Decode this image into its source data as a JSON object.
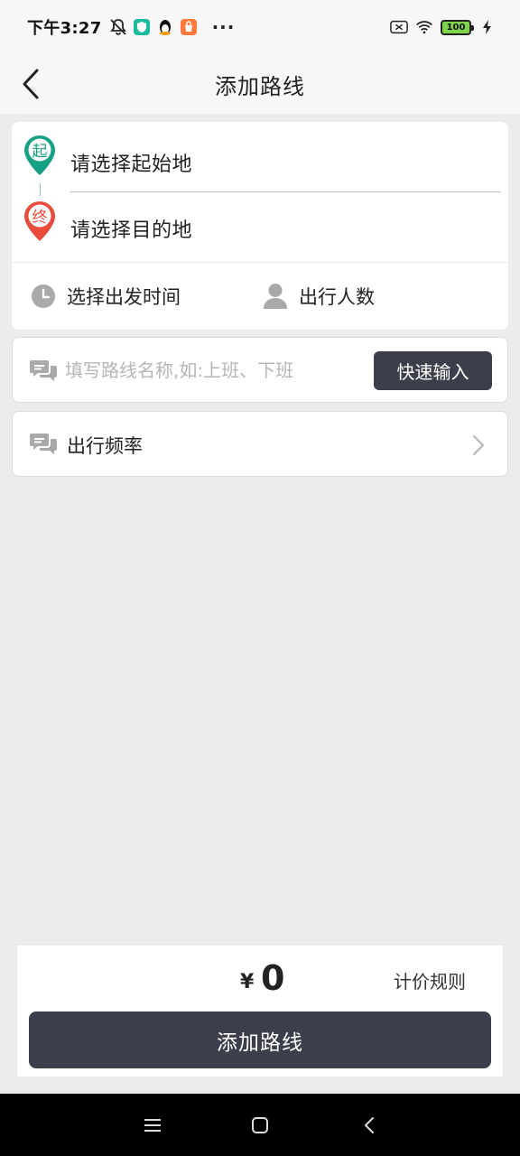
{
  "status_bar": {
    "time": "下午3:27",
    "dots": "···",
    "battery_level": "100"
  },
  "header": {
    "title": "添加路线"
  },
  "route": {
    "start_badge": "起",
    "end_badge": "终",
    "start_placeholder": "请选择起始地",
    "end_placeholder": "请选择目的地",
    "departure_time_label": "选择出发时间",
    "passengers_label": "出行人数"
  },
  "route_name": {
    "placeholder": "填写路线名称,如:上班、下班",
    "value": "",
    "quick_input_label": "快速输入"
  },
  "frequency": {
    "label": "出行频率"
  },
  "footer": {
    "currency_symbol": "¥",
    "price": "0",
    "pricing_rules_label": "计价规则",
    "submit_label": "添加路线"
  },
  "colors": {
    "start_pin": "#16a085",
    "end_pin": "#e74c3c",
    "primary_button": "#3c3e4b",
    "background": "#ebeceb"
  }
}
